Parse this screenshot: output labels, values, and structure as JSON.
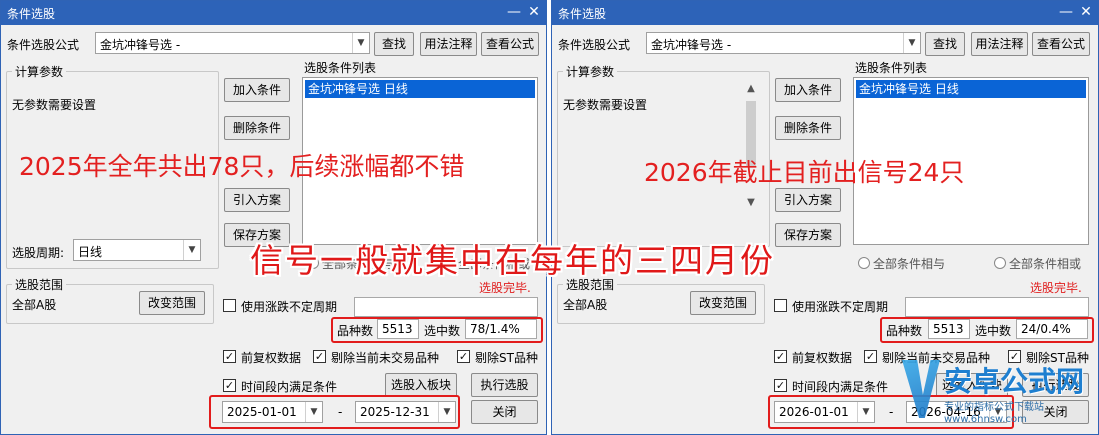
{
  "windows": [
    {
      "title": "条件选股",
      "formula_label": "条件选股公式",
      "formula_value": "金坑冲锋号选  -",
      "btn_find": "查找",
      "btn_usage": "用法注释",
      "btn_view": "查看公式",
      "calc_params_title": "计算参数",
      "no_params": "无参数需要设置",
      "cond_list_title": "选股条件列表",
      "cond_item": "金坑冲锋号选  日线",
      "btn_add": "加入条件",
      "btn_delete": "删除条件",
      "btn_import": "引入方案",
      "btn_save": "保存方案",
      "period_label": "选股周期:",
      "period_value": "日线",
      "all_and": "全部条件相与",
      "all_or": "全部条件相或",
      "done": "选股完毕.",
      "scope_title": "选股范围",
      "scope_value": "全部A股",
      "btn_change_scope": "改变范围",
      "chk_irregular": "使用涨跌不定周期",
      "count_label": "品种数",
      "count_value": "5513",
      "selected_label": "选中数",
      "selected_value": "78/1.4%",
      "chk_forward": "前复权数据",
      "chk_exclude_untraded": "剔除当前未交易品种",
      "chk_exclude_st": "剔除ST品种",
      "chk_period": "时间段内满足条件",
      "btn_to_block": "选股入板块",
      "btn_execute": "执行选股",
      "date_from": "2025-01-01",
      "date_sep": "-",
      "date_to": "2025-12-31",
      "btn_close": "关闭",
      "annotation": "2025年全年共出78只，后续涨幅都不错"
    },
    {
      "title": "条件选股",
      "formula_label": "条件选股公式",
      "formula_value": "金坑冲锋号选  -",
      "btn_find": "查找",
      "btn_usage": "用法注释",
      "btn_view": "查看公式",
      "calc_params_title": "计算参数",
      "no_params": "无参数需要设置",
      "cond_list_title": "选股条件列表",
      "cond_item": "金坑冲锋号选  日线",
      "btn_add": "加入条件",
      "btn_delete": "删除条件",
      "btn_import": "引入方案",
      "btn_save": "保存方案",
      "all_and": "全部条件相与",
      "all_or": "全部条件相或",
      "done": "选股完毕.",
      "scope_title": "选股范围",
      "scope_value": "全部A股",
      "btn_change_scope": "改变范围",
      "chk_irregular": "使用涨跌不定周期",
      "count_label": "品种数",
      "count_value": "5513",
      "selected_label": "选中数",
      "selected_value": "24/0.4%",
      "chk_forward": "前复权数据",
      "chk_exclude_untraded": "剔除当前未交易品种",
      "chk_exclude_st": "剔除ST品种",
      "chk_period": "时间段内满足条件",
      "btn_to_block": "选股入板块",
      "btn_execute": "执行选股",
      "date_from": "2026-01-01",
      "date_sep": "-",
      "date_to": "2026-04-16",
      "btn_close": "关闭",
      "annotation": "2026年截止目前出信号24只"
    }
  ],
  "overlay_text": "信号一般就集中在每年的三四月份",
  "watermark": {
    "name": "安卓公式网",
    "sub": "专业的指标公式下载站",
    "url": "www.6hnsw.com"
  },
  "icons": {
    "check": "✓",
    "close": "✕",
    "minimize": "—",
    "combo_arrow": "▼",
    "scroll_up": "▲",
    "scroll_down": "▼"
  },
  "colors": {
    "title_bar": "#2d63b8",
    "selection": "#0a64d6",
    "annotation_red": "#e32020",
    "highlight_box": "#e21c1c"
  }
}
